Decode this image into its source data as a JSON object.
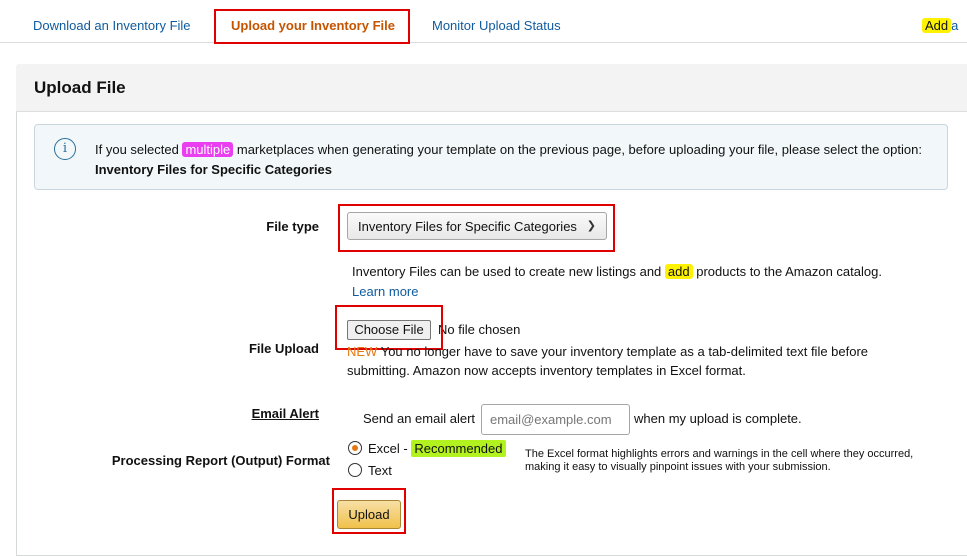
{
  "tabs": [
    {
      "label": "Download an Inventory File"
    },
    {
      "label": "Upload your Inventory File"
    },
    {
      "label": "Monitor Upload Status"
    }
  ],
  "top_right": {
    "add_label": "Add",
    "suffix": "a"
  },
  "panel": {
    "title": "Upload File"
  },
  "info": {
    "pre": "If you selected ",
    "highlight": "multiple",
    "post": " marketplaces when generating your template on the previous page, before uploading your file, please select the option:  ",
    "option": "Inventory Files for Specific Categories",
    "icon": "i"
  },
  "file_type": {
    "label": "File type",
    "selected": "Inventory Files for Specific Categories",
    "desc_pre": "Inventory Files can be used to create new listings and ",
    "desc_highlight": "add",
    "desc_post": " products to the Amazon catalog.",
    "learn_more": "Learn more"
  },
  "file_upload": {
    "label": "File Upload",
    "button": "Choose File",
    "status": "No file chosen",
    "new_tag": "NEW",
    "note": " You no longer have to save your inventory template as a tab-delimited text file before submitting. Amazon now accepts inventory templates in Excel format."
  },
  "email_alert": {
    "label": "Email Alert",
    "pre": "Send an email alert",
    "placeholder": "email@example.com",
    "post": "when my upload is complete."
  },
  "report_format": {
    "label": "Processing Report (Output) Format",
    "options": [
      {
        "label": "Excel - ",
        "badge": "Recommended",
        "checked": true
      },
      {
        "label": "Text",
        "checked": false
      }
    ],
    "note": "The Excel format highlights errors and warnings in the cell where they occurred, making it easy to visually pinpoint issues with your submission."
  },
  "upload_button": "Upload"
}
